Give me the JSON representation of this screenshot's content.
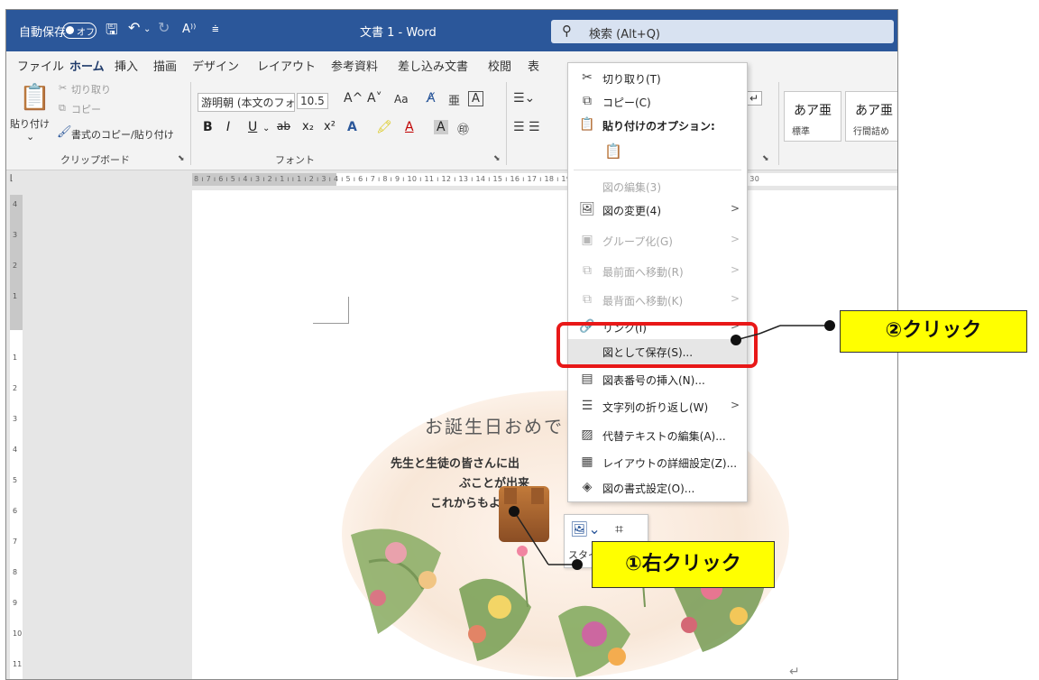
{
  "titlebar": {
    "autosave_label": "自動保存",
    "autosave_state": "オフ",
    "doc_title": "文書 1  -  Word",
    "search_placeholder": "検索 (Alt+Q)"
  },
  "tabs": [
    "ファイル",
    "ホーム",
    "挿入",
    "描画",
    "デザイン",
    "レイアウト",
    "参考資料",
    "差し込み文書",
    "校閲",
    "表"
  ],
  "active_tab": "ホーム",
  "ribbon": {
    "clipboard": {
      "paste": "貼り付け",
      "cut": "切り取り",
      "copy": "コピー",
      "format_painter": "書式のコピー/貼り付け",
      "label": "クリップボード"
    },
    "font": {
      "font_name": "游明朝 (本文のフォン",
      "font_size": "10.5",
      "grow": "A^",
      "shrink": "A˅",
      "case": "Aa",
      "label": "フォント"
    },
    "styles": [
      {
        "sample": "あア亜",
        "name": "標準"
      },
      {
        "sample": "あア亜",
        "name": "行間詰め"
      }
    ]
  },
  "card": {
    "title": "お誕生日おめで",
    "lines": [
      "先生と生徒の皆さんに出",
      "ぶことが出来",
      "これからもよろし"
    ]
  },
  "mini_toolbar": {
    "style_label": "スタイ"
  },
  "context_menu": [
    {
      "icon": "cut-icon",
      "glyph": "✂",
      "label": "切り取り(T)",
      "state": "normal"
    },
    {
      "icon": "copy-icon",
      "glyph": "⧉",
      "label": "コピー(C)",
      "state": "normal"
    },
    {
      "icon": "paste-options-icon",
      "glyph": "📋",
      "label": "貼り付けのオプション:",
      "state": "bold"
    },
    {
      "icon": "paste-keep-icon",
      "glyph": "📋",
      "label": "",
      "state": "normal"
    },
    {
      "icon": "",
      "glyph": "",
      "label": "図の編集(3)",
      "state": "disabled"
    },
    {
      "icon": "change-picture-icon",
      "glyph": "🖼",
      "label": "図の変更(4)",
      "state": "normal",
      "arrow": ">"
    },
    {
      "icon": "group-icon",
      "glyph": "▣",
      "label": "グループ化(G)",
      "state": "disabled",
      "arrow": ">"
    },
    {
      "icon": "bring-front-icon",
      "glyph": "⧉",
      "label": "最前面へ移動(R)",
      "state": "disabled",
      "arrow": ">"
    },
    {
      "icon": "send-back-icon",
      "glyph": "⧉",
      "label": "最背面へ移動(K)",
      "state": "disabled",
      "arrow": ">"
    },
    {
      "icon": "link-icon",
      "glyph": "🔗",
      "label": "リンク(I)",
      "state": "normal",
      "arrow": ">"
    },
    {
      "icon": "",
      "glyph": "",
      "label": "図として保存(S)...",
      "state": "highlight"
    },
    {
      "icon": "insert-caption-icon",
      "glyph": "▤",
      "label": "図表番号の挿入(N)...",
      "state": "normal"
    },
    {
      "icon": "wrap-text-icon",
      "glyph": "☰",
      "label": "文字列の折り返し(W)",
      "state": "normal",
      "arrow": ">"
    },
    {
      "icon": "alt-text-icon",
      "glyph": "▨",
      "label": "代替テキストの編集(A)...",
      "state": "normal"
    },
    {
      "icon": "layout-options-icon",
      "glyph": "▦",
      "label": "レイアウトの詳細設定(Z)...",
      "state": "normal"
    },
    {
      "icon": "format-picture-icon",
      "glyph": "◈",
      "label": "図の書式設定(O)...",
      "state": "normal"
    }
  ],
  "annotations": {
    "step1": "①右クリック",
    "step2": "②クリック"
  },
  "colors": {
    "titlebar": "#2b579a",
    "highlight_box": "#e81818",
    "callout_fill": "#ffff00"
  }
}
